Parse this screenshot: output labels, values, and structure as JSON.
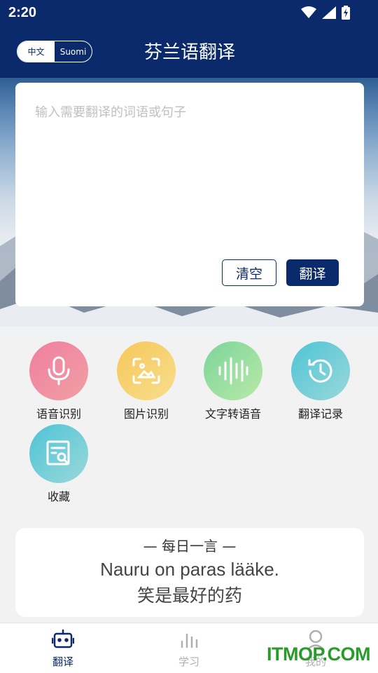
{
  "status": {
    "time": "2:20"
  },
  "app": {
    "title": "芬兰语翻译"
  },
  "lang_toggle": {
    "left": "中文",
    "right": "Suomi"
  },
  "translate": {
    "placeholder": "输入需要翻译的词语或句子",
    "clear_label": "清空",
    "translate_label": "翻译"
  },
  "features": [
    {
      "label": "语音识别",
      "icon": "microphone-icon",
      "color_from": "#f07ea0",
      "color_to": "#f0a0a4"
    },
    {
      "label": "图片识别",
      "icon": "image-scan-icon",
      "color_from": "#f6c85a",
      "color_to": "#f8dd8c"
    },
    {
      "label": "文字转语音",
      "icon": "waveform-icon",
      "color_from": "#7dd49a",
      "color_to": "#b8eaa8"
    },
    {
      "label": "翻译记录",
      "icon": "history-clock-icon",
      "color_from": "#4ec4d6",
      "color_to": "#9ad8da"
    },
    {
      "label": "收藏",
      "icon": "favorites-doc-icon",
      "color_from": "#4ec4d6",
      "color_to": "#9ad8da"
    }
  ],
  "quote": {
    "heading": "—  每日一言  —",
    "finnish": "Nauru on paras lääke.",
    "chinese": "笑是最好的药"
  },
  "bottom_nav": [
    {
      "label": "翻译",
      "icon": "robot-icon",
      "active": true
    },
    {
      "label": "学习",
      "icon": "bar-chart-icon",
      "active": false
    },
    {
      "label": "我的",
      "icon": "profile-icon",
      "active": false
    }
  ],
  "watermark": "ITMOP.COM",
  "colors": {
    "primary": "#0b2a6b",
    "watermark": "#2a9a2a"
  }
}
